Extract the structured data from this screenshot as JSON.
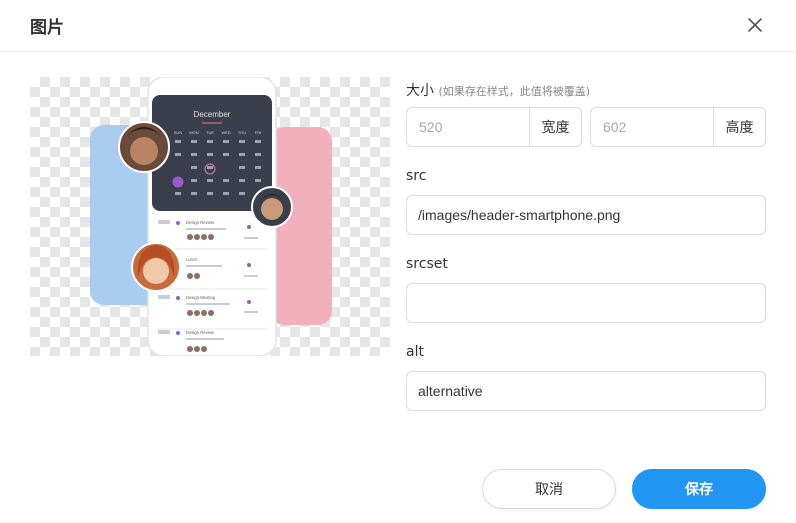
{
  "dialog": {
    "title": "图片",
    "close_icon": "close-icon"
  },
  "form": {
    "size_label": "大小",
    "size_hint": "(如果存在样式，此值将被覆盖)",
    "width_placeholder": "520",
    "width_unit": "宽度",
    "height_placeholder": "602",
    "height_unit": "高度",
    "src_label": "src",
    "src_value": "/images/header-smartphone.png",
    "srcset_label": "srcset",
    "srcset_value": "",
    "alt_label": "alt",
    "alt_value": "alternative"
  },
  "preview": {
    "month": "December",
    "weekdays": [
      "SUN",
      "MON",
      "TUE",
      "WED",
      "THU",
      "FRI",
      "SAT"
    ],
    "event_titles": [
      "Design Review",
      "Lunch",
      "Design Meeting",
      "Design Review"
    ]
  },
  "footer": {
    "cancel_label": "取消",
    "save_label": "保存"
  },
  "colors": {
    "primary": "#2196f3",
    "preview_blue": "#a9ccf0",
    "preview_pink": "#f2b0bd"
  }
}
